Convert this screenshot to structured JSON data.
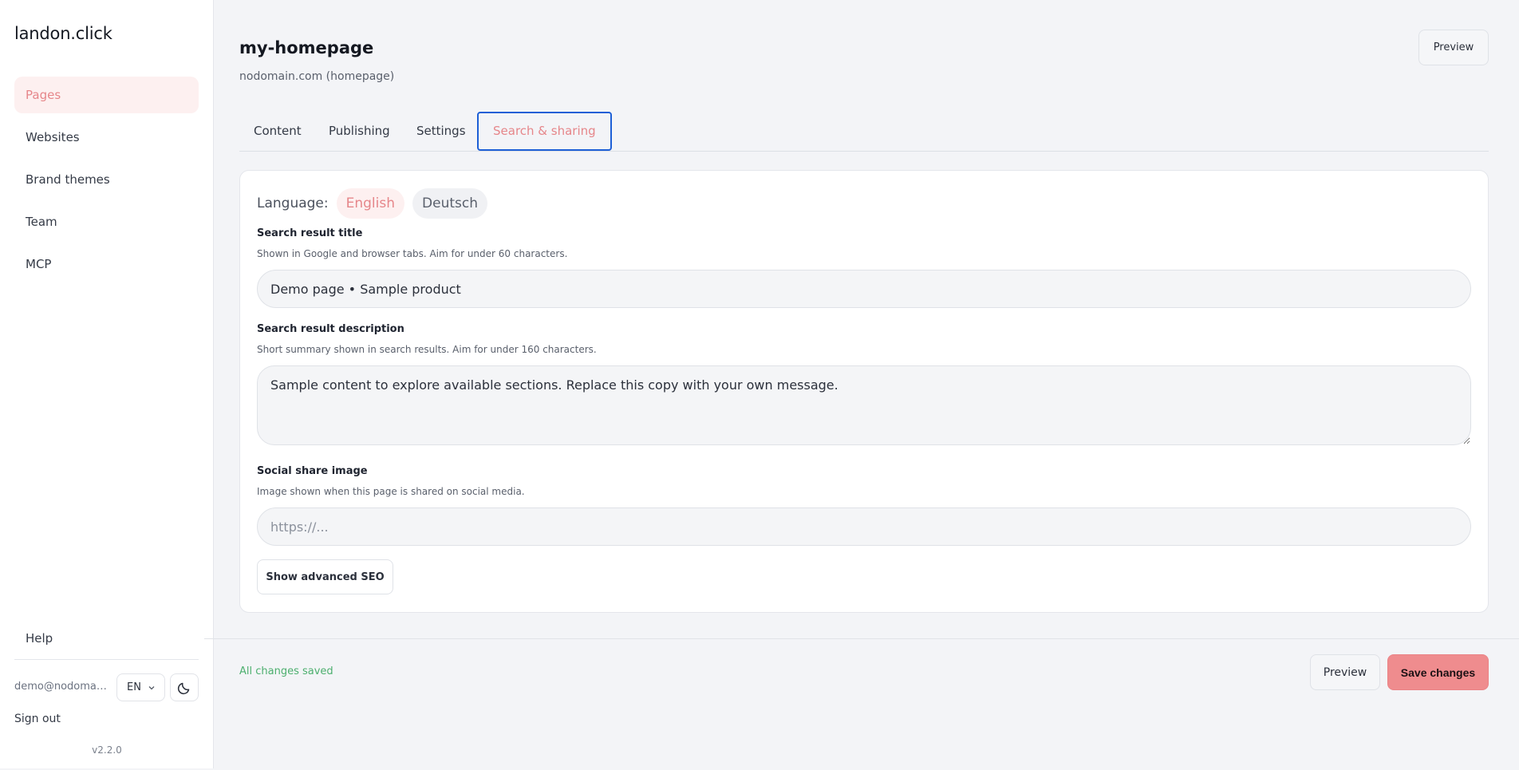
{
  "sidebar": {
    "brand": "landon.click",
    "nav": [
      {
        "label": "Pages",
        "active": true
      },
      {
        "label": "Websites"
      },
      {
        "label": "Brand themes"
      },
      {
        "label": "Team"
      },
      {
        "label": "MCP"
      }
    ],
    "help": "Help",
    "email": "demo@nodomain....",
    "language": "EN",
    "sign_out": "Sign out",
    "version": "v2.2.0"
  },
  "header": {
    "title": "my-homepage",
    "subtitle": "nodomain.com (homepage)",
    "preview": "Preview"
  },
  "tabs": [
    {
      "label": "Content"
    },
    {
      "label": "Publishing"
    },
    {
      "label": "Settings"
    },
    {
      "label": "Search & sharing",
      "active": true
    }
  ],
  "form": {
    "language_label": "Language:",
    "languages": [
      "English",
      "Deutsch"
    ],
    "title_label": "Search result title",
    "title_help": "Shown in Google and browser tabs. Aim for under 60 characters.",
    "title_value": "Demo page • Sample product",
    "description_label": "Search result description",
    "description_help": "Short summary shown in search results. Aim for under 160 characters.",
    "description_value": "Sample content to explore available sections. Replace this copy with your own message.",
    "image_label": "Social share image",
    "image_help": "Image shown when this page is shared on social media.",
    "image_placeholder": "https://...",
    "advanced": "Show advanced SEO"
  },
  "footer": {
    "status": "All changes saved",
    "preview": "Preview",
    "save": "Save changes"
  },
  "colors": {
    "accent": "#ef8c8e",
    "accent_text": "#e6868a",
    "focus": "#1d5fd6",
    "success": "#4caf6e"
  }
}
